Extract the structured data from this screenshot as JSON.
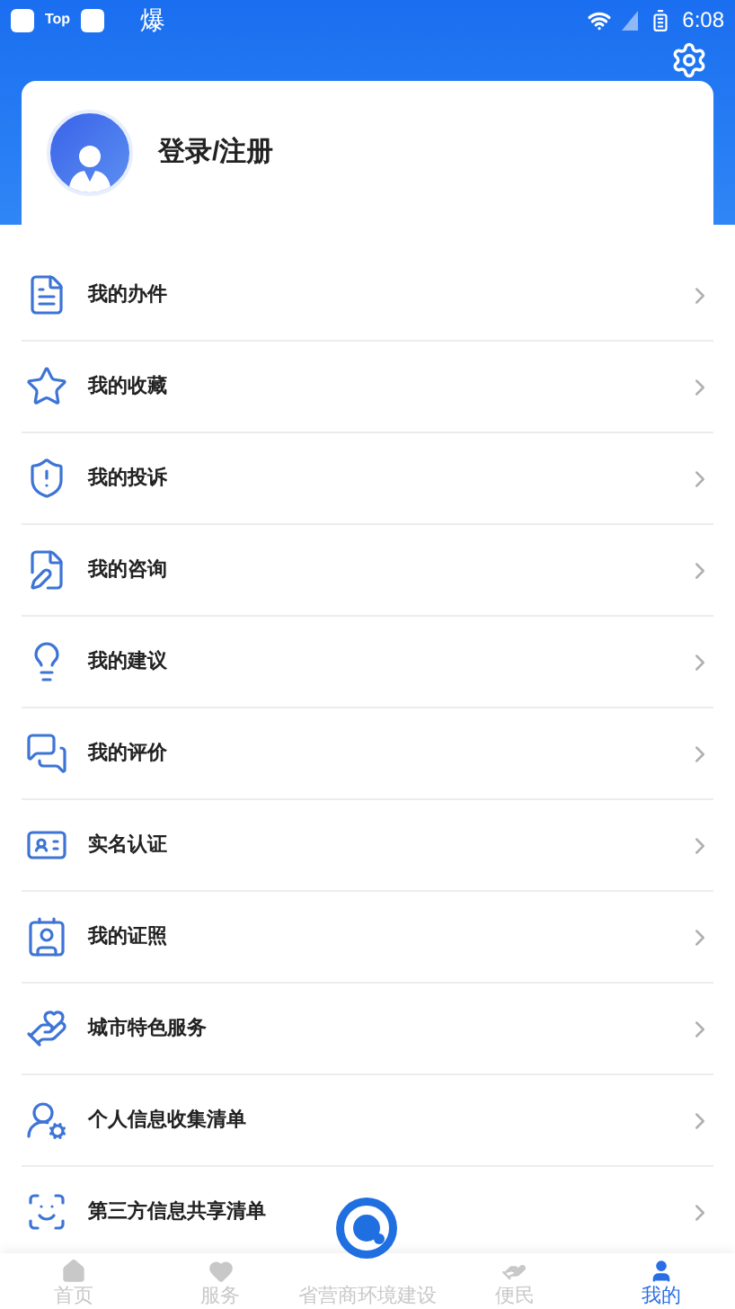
{
  "status_bar": {
    "left_label": "Top",
    "left_glyph": "爆",
    "time": "6:08"
  },
  "profile": {
    "title": "登录/注册"
  },
  "menu": [
    {
      "label": "我的办件"
    },
    {
      "label": "我的收藏"
    },
    {
      "label": "我的投诉"
    },
    {
      "label": "我的咨询"
    },
    {
      "label": "我的建议"
    },
    {
      "label": "我的评价"
    },
    {
      "label": "实名认证"
    },
    {
      "label": "我的证照"
    },
    {
      "label": "城市特色服务"
    },
    {
      "label": "个人信息收集清单"
    },
    {
      "label": "第三方信息共享清单"
    }
  ],
  "tab_bar": [
    {
      "label": "首页",
      "selected": false
    },
    {
      "label": "服务",
      "selected": false
    },
    {
      "label": "省营商环境建设",
      "selected": false
    },
    {
      "label": "便民",
      "selected": false
    },
    {
      "label": "我的",
      "selected": true
    }
  ]
}
